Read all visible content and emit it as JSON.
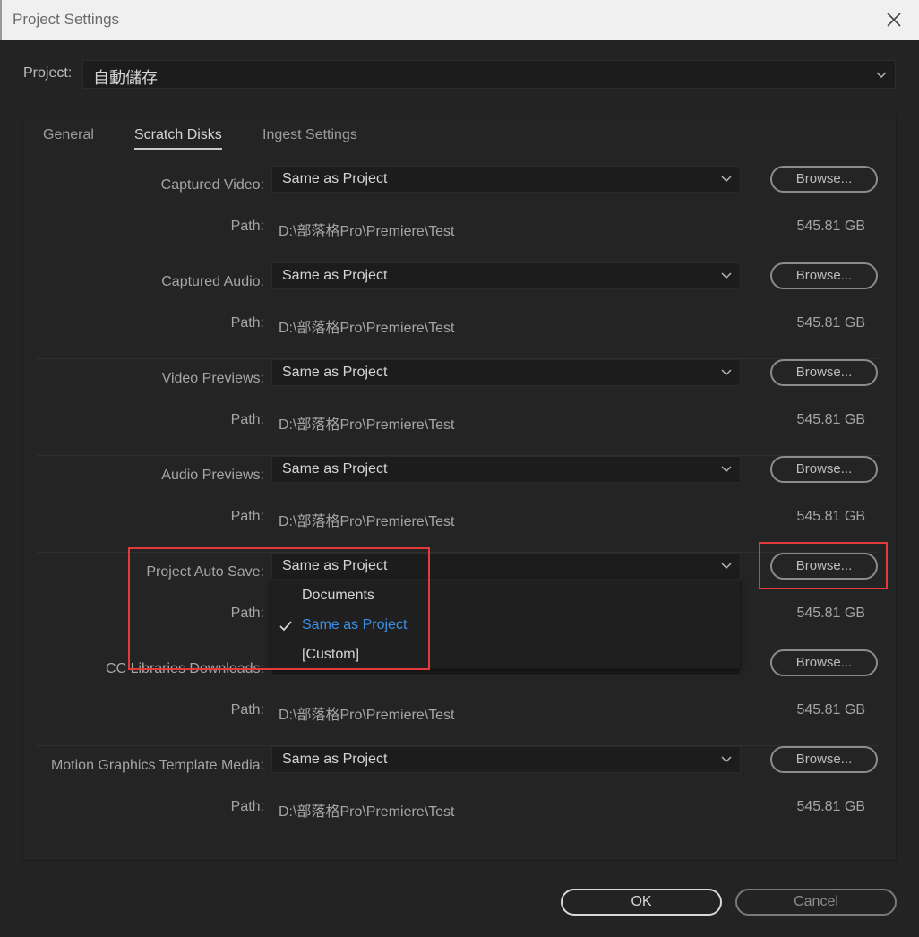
{
  "window": {
    "title": "Project Settings"
  },
  "project": {
    "label": "Project:",
    "value": "自動儲存"
  },
  "tabs": [
    {
      "label": "General",
      "active": false
    },
    {
      "label": "Scratch Disks",
      "active": true
    },
    {
      "label": "Ingest Settings",
      "active": false
    }
  ],
  "groups": [
    {
      "label": "Captured Video:",
      "value": "Same as Project",
      "browse": "Browse...",
      "path_label": "Path:",
      "path": "D:\\部落格Pro\\Premiere\\Test",
      "size": "545.81 GB"
    },
    {
      "label": "Captured Audio:",
      "value": "Same as Project",
      "browse": "Browse...",
      "path_label": "Path:",
      "path": "D:\\部落格Pro\\Premiere\\Test",
      "size": "545.81 GB"
    },
    {
      "label": "Video Previews:",
      "value": "Same as Project",
      "browse": "Browse...",
      "path_label": "Path:",
      "path": "D:\\部落格Pro\\Premiere\\Test",
      "size": "545.81 GB"
    },
    {
      "label": "Audio Previews:",
      "value": "Same as Project",
      "browse": "Browse...",
      "path_label": "Path:",
      "path": "D:\\部落格Pro\\Premiere\\Test",
      "size": "545.81 GB"
    },
    {
      "label": "Project Auto Save:",
      "value": "Same as Project",
      "browse": "Browse...",
      "path_label": "Path:",
      "path": "",
      "size": "545.81 GB"
    },
    {
      "label": "CC Libraries Downloads:",
      "value": "",
      "browse": "Browse...",
      "path_label": "Path:",
      "path": "D:\\部落格Pro\\Premiere\\Test",
      "size": "545.81 GB"
    },
    {
      "label": "Motion Graphics Template Media:",
      "value": "Same as Project",
      "browse": "Browse...",
      "path_label": "Path:",
      "path": "D:\\部落格Pro\\Premiere\\Test",
      "size": "545.81 GB"
    }
  ],
  "autosave_menu": {
    "items": [
      {
        "label": "Documents",
        "selected": false
      },
      {
        "label": "Same as Project",
        "selected": true
      },
      {
        "label": "[Custom]",
        "selected": false
      }
    ]
  },
  "footer": {
    "ok_label": "OK",
    "cancel_label": "Cancel"
  },
  "colors": {
    "highlight": "#e33a3a",
    "selected_item": "#3b8fe6",
    "background": "#232323"
  }
}
